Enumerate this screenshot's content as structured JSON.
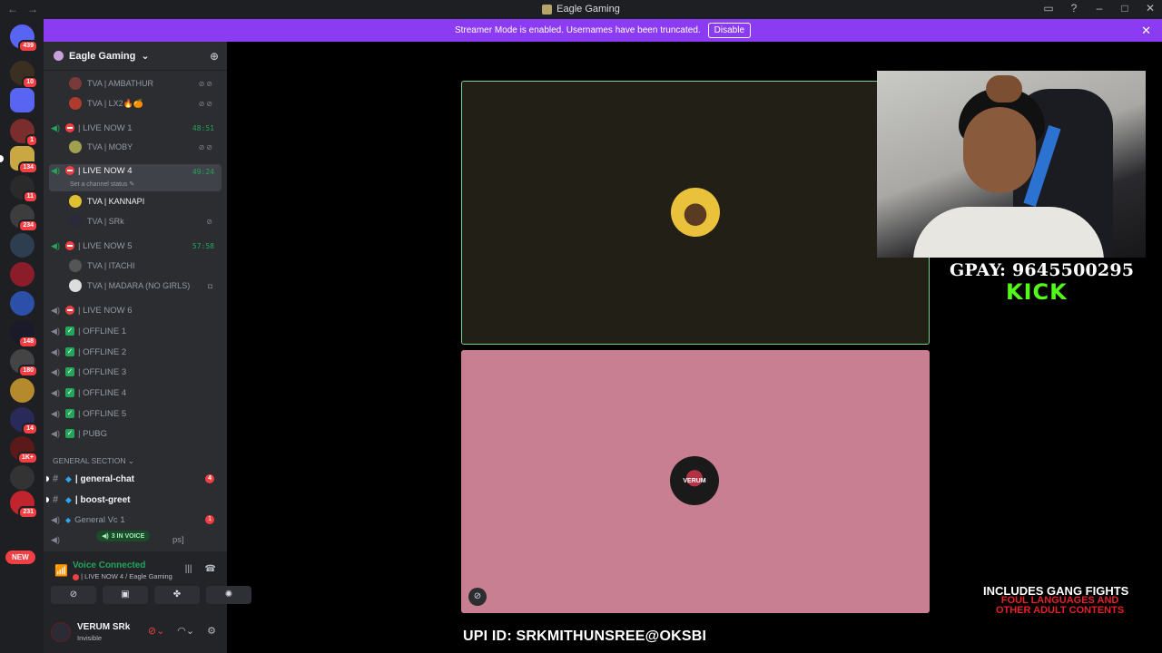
{
  "window": {
    "title": "Eagle Gaming"
  },
  "banner": {
    "message": "Streamer Mode is enabled. Usernames have been truncated.",
    "disable_label": "Disable"
  },
  "rail": {
    "badges": [
      "439",
      "10",
      "1",
      "134",
      "11",
      "234",
      "148",
      "180",
      "14",
      "1K+",
      "231"
    ],
    "new_label": "NEW"
  },
  "guild": {
    "name": "Eagle Gaming"
  },
  "channels": {
    "members_top": [
      {
        "name": "TVA | AMBATHUR"
      },
      {
        "name": "TVA | LX2🔥🍊"
      }
    ],
    "live1": {
      "label": "| LIVE NOW 1",
      "time": "48:51",
      "member": "TVA | MOBY"
    },
    "live4": {
      "label": "| LIVE NOW 4",
      "time": "49:24",
      "status": "Set a channel status",
      "members": [
        "TVA | KANNAPI",
        "TVA | SRk"
      ]
    },
    "live5": {
      "label": "| LIVE NOW 5",
      "time": "57:58",
      "members": [
        "TVA | ITACHI",
        "TVA | MADARA (NO GIRLS)"
      ]
    },
    "live6": {
      "label": "| LIVE NOW 6"
    },
    "offline": [
      "| OFFLINE 1",
      "| OFFLINE 2",
      "| OFFLINE 3",
      "| OFFLINE 4",
      "| OFFLINE 5",
      "| PUBG"
    ],
    "category": "GENERAL SECTION",
    "text": [
      {
        "label": "| general-chat",
        "count": "4"
      },
      {
        "label": "| boost-greet",
        "count": ""
      }
    ],
    "general_vc": {
      "label": "General Vc 1",
      "count": "1"
    },
    "ps_row": "ps]",
    "in_voice": "3 IN VOICE"
  },
  "voice": {
    "title": "Voice Connected",
    "subtitle": "| LIVE NOW 4 / Eagle Gaming"
  },
  "user": {
    "name": "VERUM SRk",
    "status": "Invisible"
  },
  "stage": {
    "tile2_label": "VERUM"
  },
  "overlay": {
    "gpay": "GPAY: 9645500295",
    "kick": "KICK",
    "upi": "UPI ID: SRKMITHUNSREE@OKSBI",
    "warning_line1": "INCLUDES GANG FIGHTS",
    "warning_line2": "FOUL LANGUAGES AND",
    "warning_line3": "OTHER ADULT CONTENTS"
  },
  "colors": {
    "accent": "#8b3cf2",
    "live_green": "#23a55a",
    "danger": "#f23f43",
    "kick": "#53fc18"
  }
}
